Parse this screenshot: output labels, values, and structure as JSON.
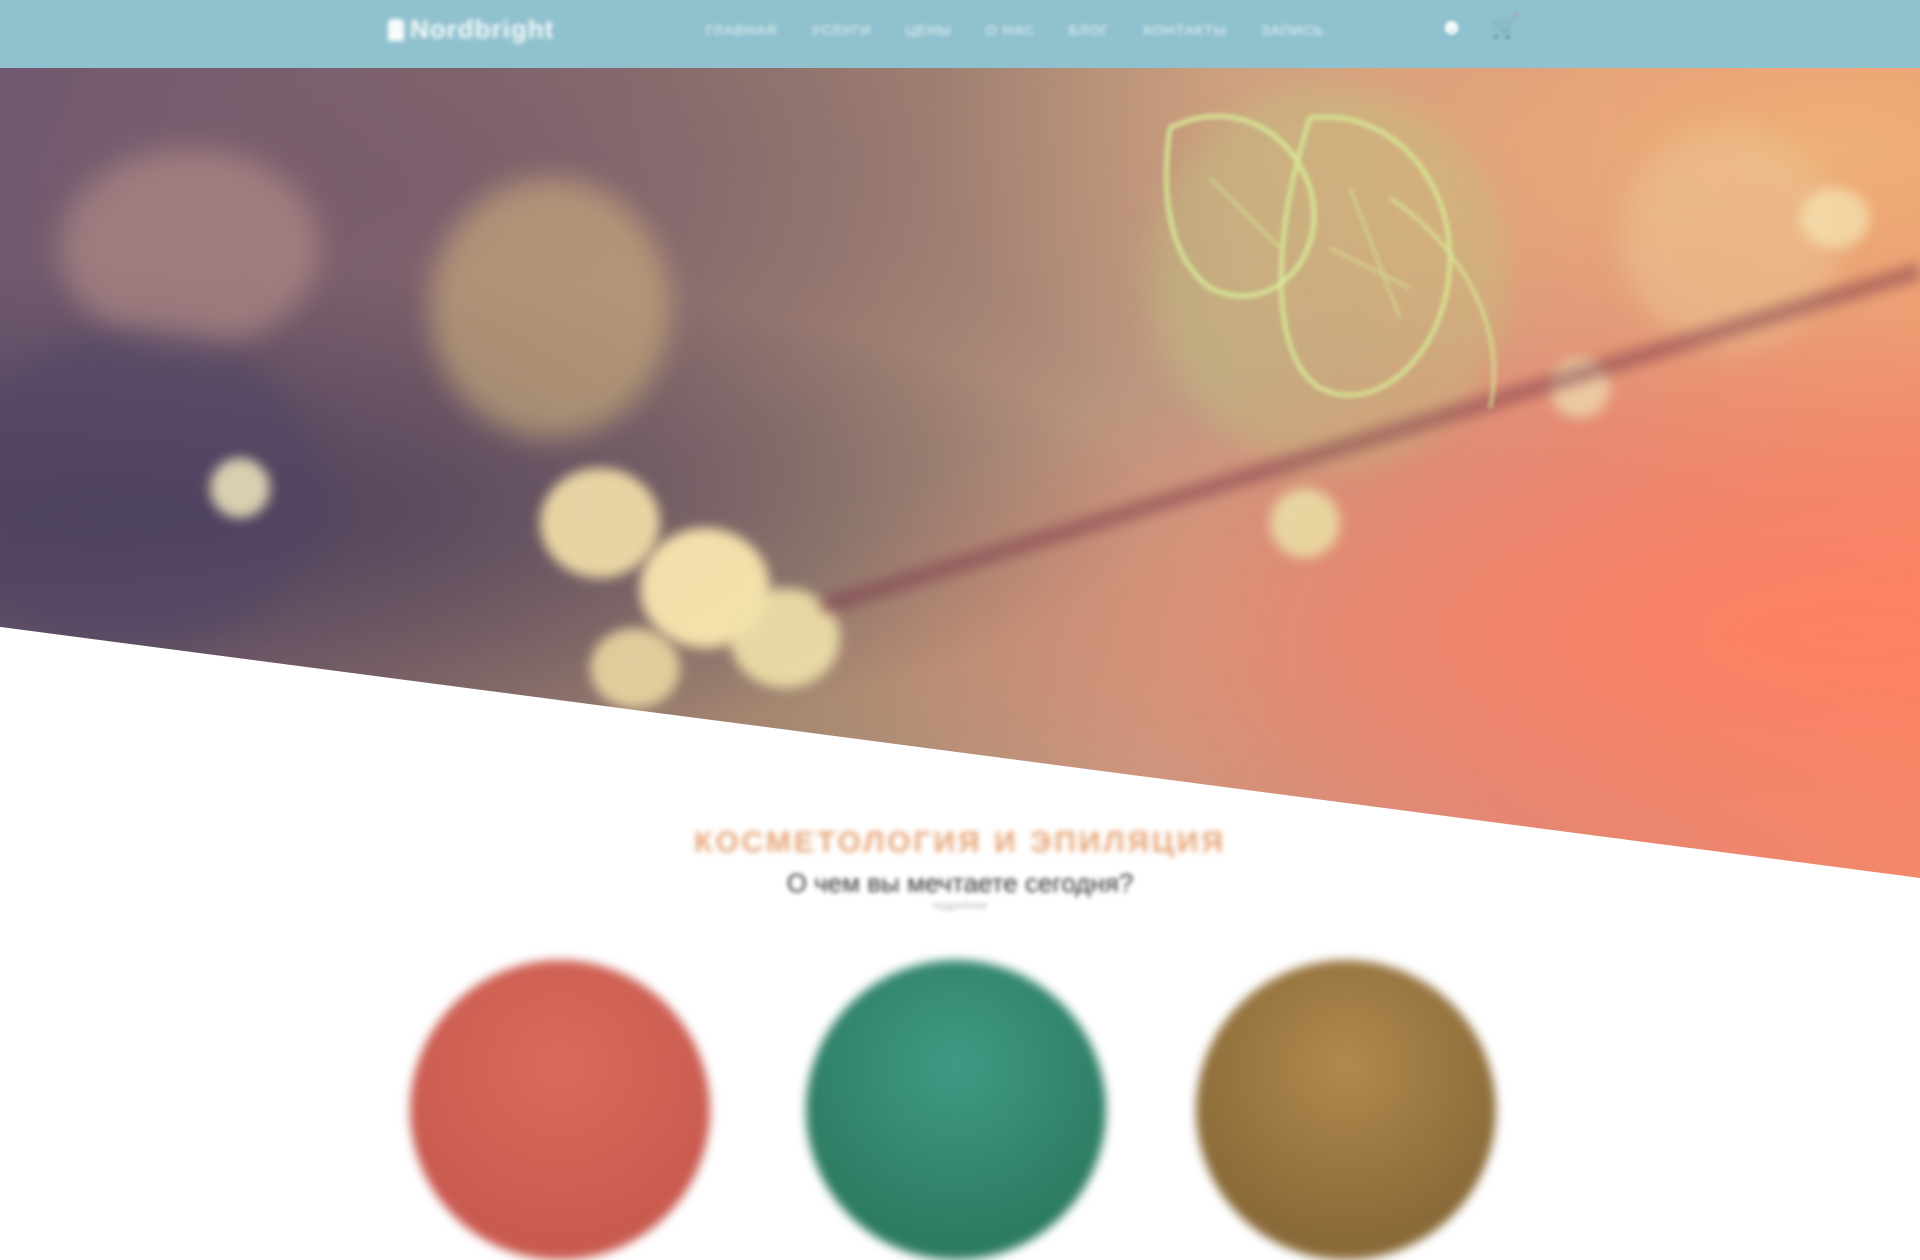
{
  "brand": {
    "logo_text": "Nordbright"
  },
  "nav": {
    "items": [
      {
        "label": "Главная"
      },
      {
        "label": "Услуги"
      },
      {
        "label": "Цены"
      },
      {
        "label": "О нас"
      },
      {
        "label": "Блог"
      },
      {
        "label": "Контакты"
      },
      {
        "label": "Запись"
      }
    ],
    "icons": [
      "user-icon",
      "cart-icon"
    ]
  },
  "hero": {
    "image": "blossom-branch-photo"
  },
  "section": {
    "title": "Косметология и эпиляция",
    "subtitle": "О чем вы мечтаете сегодня?",
    "small": "подробнее"
  },
  "cards": [
    {
      "color": "#d96b5c"
    },
    {
      "color": "#3f9a83"
    },
    {
      "color": "#b08a4e"
    }
  ],
  "colors": {
    "topbar": "#8fc1ce",
    "accent": "#e6a577"
  }
}
